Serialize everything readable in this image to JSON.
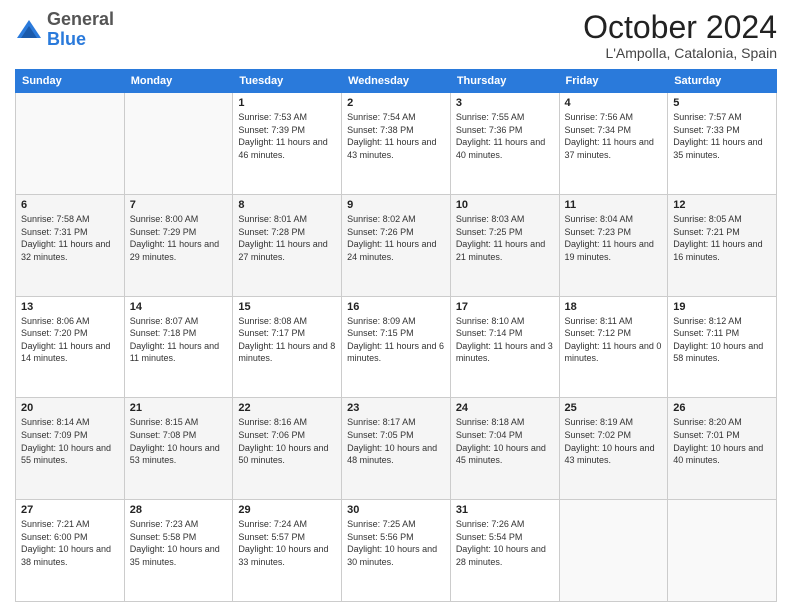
{
  "header": {
    "logo_general": "General",
    "logo_blue": "Blue",
    "month_title": "October 2024",
    "location": "L'Ampolla, Catalonia, Spain"
  },
  "weekdays": [
    "Sunday",
    "Monday",
    "Tuesday",
    "Wednesday",
    "Thursday",
    "Friday",
    "Saturday"
  ],
  "weeks": [
    [
      {
        "day": "",
        "sunrise": "",
        "sunset": "",
        "daylight": ""
      },
      {
        "day": "",
        "sunrise": "",
        "sunset": "",
        "daylight": ""
      },
      {
        "day": "1",
        "sunrise": "Sunrise: 7:53 AM",
        "sunset": "Sunset: 7:39 PM",
        "daylight": "Daylight: 11 hours and 46 minutes."
      },
      {
        "day": "2",
        "sunrise": "Sunrise: 7:54 AM",
        "sunset": "Sunset: 7:38 PM",
        "daylight": "Daylight: 11 hours and 43 minutes."
      },
      {
        "day": "3",
        "sunrise": "Sunrise: 7:55 AM",
        "sunset": "Sunset: 7:36 PM",
        "daylight": "Daylight: 11 hours and 40 minutes."
      },
      {
        "day": "4",
        "sunrise": "Sunrise: 7:56 AM",
        "sunset": "Sunset: 7:34 PM",
        "daylight": "Daylight: 11 hours and 37 minutes."
      },
      {
        "day": "5",
        "sunrise": "Sunrise: 7:57 AM",
        "sunset": "Sunset: 7:33 PM",
        "daylight": "Daylight: 11 hours and 35 minutes."
      }
    ],
    [
      {
        "day": "6",
        "sunrise": "Sunrise: 7:58 AM",
        "sunset": "Sunset: 7:31 PM",
        "daylight": "Daylight: 11 hours and 32 minutes."
      },
      {
        "day": "7",
        "sunrise": "Sunrise: 8:00 AM",
        "sunset": "Sunset: 7:29 PM",
        "daylight": "Daylight: 11 hours and 29 minutes."
      },
      {
        "day": "8",
        "sunrise": "Sunrise: 8:01 AM",
        "sunset": "Sunset: 7:28 PM",
        "daylight": "Daylight: 11 hours and 27 minutes."
      },
      {
        "day": "9",
        "sunrise": "Sunrise: 8:02 AM",
        "sunset": "Sunset: 7:26 PM",
        "daylight": "Daylight: 11 hours and 24 minutes."
      },
      {
        "day": "10",
        "sunrise": "Sunrise: 8:03 AM",
        "sunset": "Sunset: 7:25 PM",
        "daylight": "Daylight: 11 hours and 21 minutes."
      },
      {
        "day": "11",
        "sunrise": "Sunrise: 8:04 AM",
        "sunset": "Sunset: 7:23 PM",
        "daylight": "Daylight: 11 hours and 19 minutes."
      },
      {
        "day": "12",
        "sunrise": "Sunrise: 8:05 AM",
        "sunset": "Sunset: 7:21 PM",
        "daylight": "Daylight: 11 hours and 16 minutes."
      }
    ],
    [
      {
        "day": "13",
        "sunrise": "Sunrise: 8:06 AM",
        "sunset": "Sunset: 7:20 PM",
        "daylight": "Daylight: 11 hours and 14 minutes."
      },
      {
        "day": "14",
        "sunrise": "Sunrise: 8:07 AM",
        "sunset": "Sunset: 7:18 PM",
        "daylight": "Daylight: 11 hours and 11 minutes."
      },
      {
        "day": "15",
        "sunrise": "Sunrise: 8:08 AM",
        "sunset": "Sunset: 7:17 PM",
        "daylight": "Daylight: 11 hours and 8 minutes."
      },
      {
        "day": "16",
        "sunrise": "Sunrise: 8:09 AM",
        "sunset": "Sunset: 7:15 PM",
        "daylight": "Daylight: 11 hours and 6 minutes."
      },
      {
        "day": "17",
        "sunrise": "Sunrise: 8:10 AM",
        "sunset": "Sunset: 7:14 PM",
        "daylight": "Daylight: 11 hours and 3 minutes."
      },
      {
        "day": "18",
        "sunrise": "Sunrise: 8:11 AM",
        "sunset": "Sunset: 7:12 PM",
        "daylight": "Daylight: 11 hours and 0 minutes."
      },
      {
        "day": "19",
        "sunrise": "Sunrise: 8:12 AM",
        "sunset": "Sunset: 7:11 PM",
        "daylight": "Daylight: 10 hours and 58 minutes."
      }
    ],
    [
      {
        "day": "20",
        "sunrise": "Sunrise: 8:14 AM",
        "sunset": "Sunset: 7:09 PM",
        "daylight": "Daylight: 10 hours and 55 minutes."
      },
      {
        "day": "21",
        "sunrise": "Sunrise: 8:15 AM",
        "sunset": "Sunset: 7:08 PM",
        "daylight": "Daylight: 10 hours and 53 minutes."
      },
      {
        "day": "22",
        "sunrise": "Sunrise: 8:16 AM",
        "sunset": "Sunset: 7:06 PM",
        "daylight": "Daylight: 10 hours and 50 minutes."
      },
      {
        "day": "23",
        "sunrise": "Sunrise: 8:17 AM",
        "sunset": "Sunset: 7:05 PM",
        "daylight": "Daylight: 10 hours and 48 minutes."
      },
      {
        "day": "24",
        "sunrise": "Sunrise: 8:18 AM",
        "sunset": "Sunset: 7:04 PM",
        "daylight": "Daylight: 10 hours and 45 minutes."
      },
      {
        "day": "25",
        "sunrise": "Sunrise: 8:19 AM",
        "sunset": "Sunset: 7:02 PM",
        "daylight": "Daylight: 10 hours and 43 minutes."
      },
      {
        "day": "26",
        "sunrise": "Sunrise: 8:20 AM",
        "sunset": "Sunset: 7:01 PM",
        "daylight": "Daylight: 10 hours and 40 minutes."
      }
    ],
    [
      {
        "day": "27",
        "sunrise": "Sunrise: 7:21 AM",
        "sunset": "Sunset: 6:00 PM",
        "daylight": "Daylight: 10 hours and 38 minutes."
      },
      {
        "day": "28",
        "sunrise": "Sunrise: 7:23 AM",
        "sunset": "Sunset: 5:58 PM",
        "daylight": "Daylight: 10 hours and 35 minutes."
      },
      {
        "day": "29",
        "sunrise": "Sunrise: 7:24 AM",
        "sunset": "Sunset: 5:57 PM",
        "daylight": "Daylight: 10 hours and 33 minutes."
      },
      {
        "day": "30",
        "sunrise": "Sunrise: 7:25 AM",
        "sunset": "Sunset: 5:56 PM",
        "daylight": "Daylight: 10 hours and 30 minutes."
      },
      {
        "day": "31",
        "sunrise": "Sunrise: 7:26 AM",
        "sunset": "Sunset: 5:54 PM",
        "daylight": "Daylight: 10 hours and 28 minutes."
      },
      {
        "day": "",
        "sunrise": "",
        "sunset": "",
        "daylight": ""
      },
      {
        "day": "",
        "sunrise": "",
        "sunset": "",
        "daylight": ""
      }
    ]
  ]
}
